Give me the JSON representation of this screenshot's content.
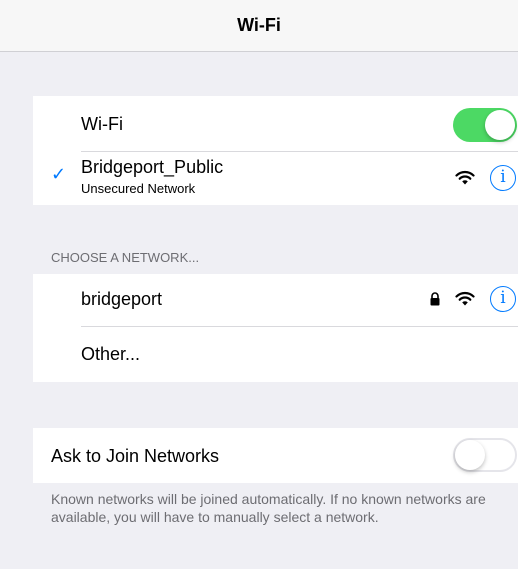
{
  "navbar": {
    "title": "Wi-Fi"
  },
  "wifi_group": {
    "wifi_label": "Wi-Fi",
    "wifi_enabled": true,
    "connected_network": {
      "name": "Bridgeport_Public",
      "status": "Unsecured Network",
      "checkmark": "✓",
      "info_glyph": "i"
    }
  },
  "networks": {
    "header": "CHOOSE A NETWORK...",
    "items": [
      {
        "name": "bridgeport",
        "locked": true,
        "info_glyph": "i"
      }
    ],
    "other_label": "Other..."
  },
  "ask_to_join": {
    "label": "Ask to Join Networks",
    "enabled": false,
    "footer": "Known networks will be joined automatically. If no known networks are available, you will have to manually select a network."
  },
  "colors": {
    "accent": "#007aff",
    "toggle_on": "#4cd964",
    "background": "#efeff4",
    "secondary_text": "#6d6d72"
  },
  "icons": {
    "checkmark": "checkmark-icon",
    "wifi_signal": "wifi-signal-icon",
    "lock": "lock-icon",
    "info": "info-icon"
  }
}
